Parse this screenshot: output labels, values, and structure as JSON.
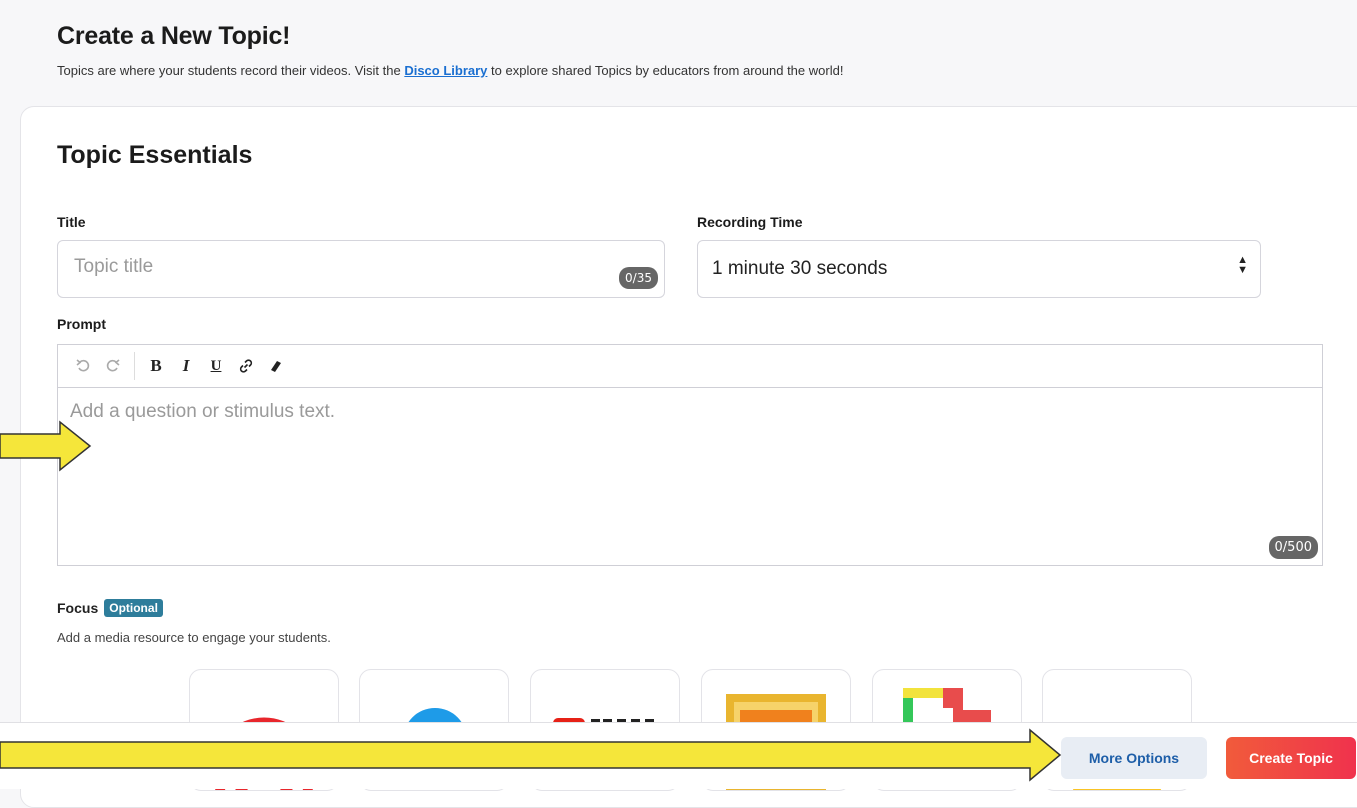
{
  "header": {
    "title": "Create a New Topic!",
    "description_before": "Topics are where your students record their videos. Visit the ",
    "library_link": "Disco Library",
    "description_after": " to explore shared Topics by educators from around the world!"
  },
  "essentials": {
    "heading": "Topic Essentials",
    "title_label": "Title",
    "title_placeholder": "Topic title",
    "title_counter": "0/35",
    "recording_label": "Recording Time",
    "recording_value": "1 minute 30 seconds",
    "prompt_label": "Prompt",
    "prompt_placeholder": "Add a question or stimulus text.",
    "prompt_counter": "0/500"
  },
  "toolbar": {
    "bold": "B",
    "italic": "I",
    "underline": "U"
  },
  "focus": {
    "label": "Focus",
    "badge": "Optional",
    "description": "Add a media resource to engage your students."
  },
  "footer": {
    "more_options": "More Options",
    "create_topic": "Create Topic"
  },
  "colors": {
    "annotation_arrow": "#f5e63a",
    "create_button": "#f0324d",
    "link": "#1a6fd1"
  }
}
